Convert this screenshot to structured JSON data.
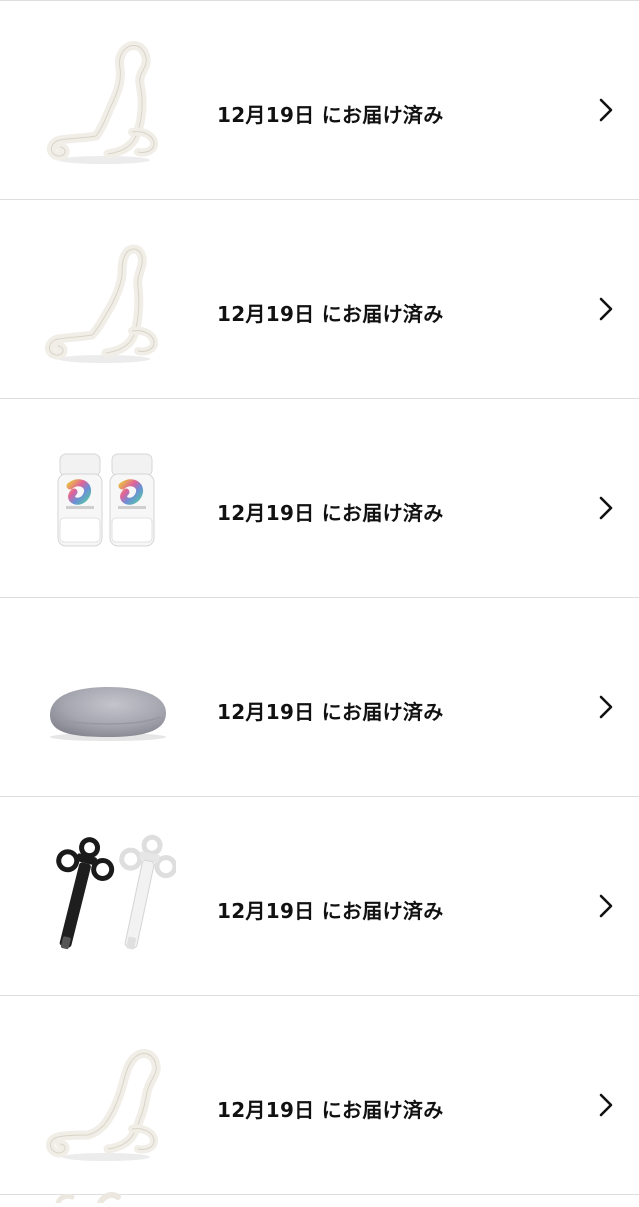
{
  "orders": [
    {
      "status": "12月19日 にお届け済み",
      "product_icon": "prostate-massager-icon"
    },
    {
      "status": "12月19日 にお届け済み",
      "product_icon": "prostate-massager-icon"
    },
    {
      "status": "12月19日 にお届け済み",
      "product_icon": "lubricant-bottles-icon"
    },
    {
      "status": "12月19日 にお届け済み",
      "product_icon": "gray-cushion-icon"
    },
    {
      "status": "12月19日 にお届け済み",
      "product_icon": "lube-applicator-syringes-icon"
    },
    {
      "status": "12月19日 にお届け済み",
      "product_icon": "prostate-massager-icon"
    }
  ],
  "row_action_icon": "chevron-right-icon",
  "colors": {
    "divider": "#dedede",
    "text": "#111111",
    "background": "#ffffff"
  }
}
